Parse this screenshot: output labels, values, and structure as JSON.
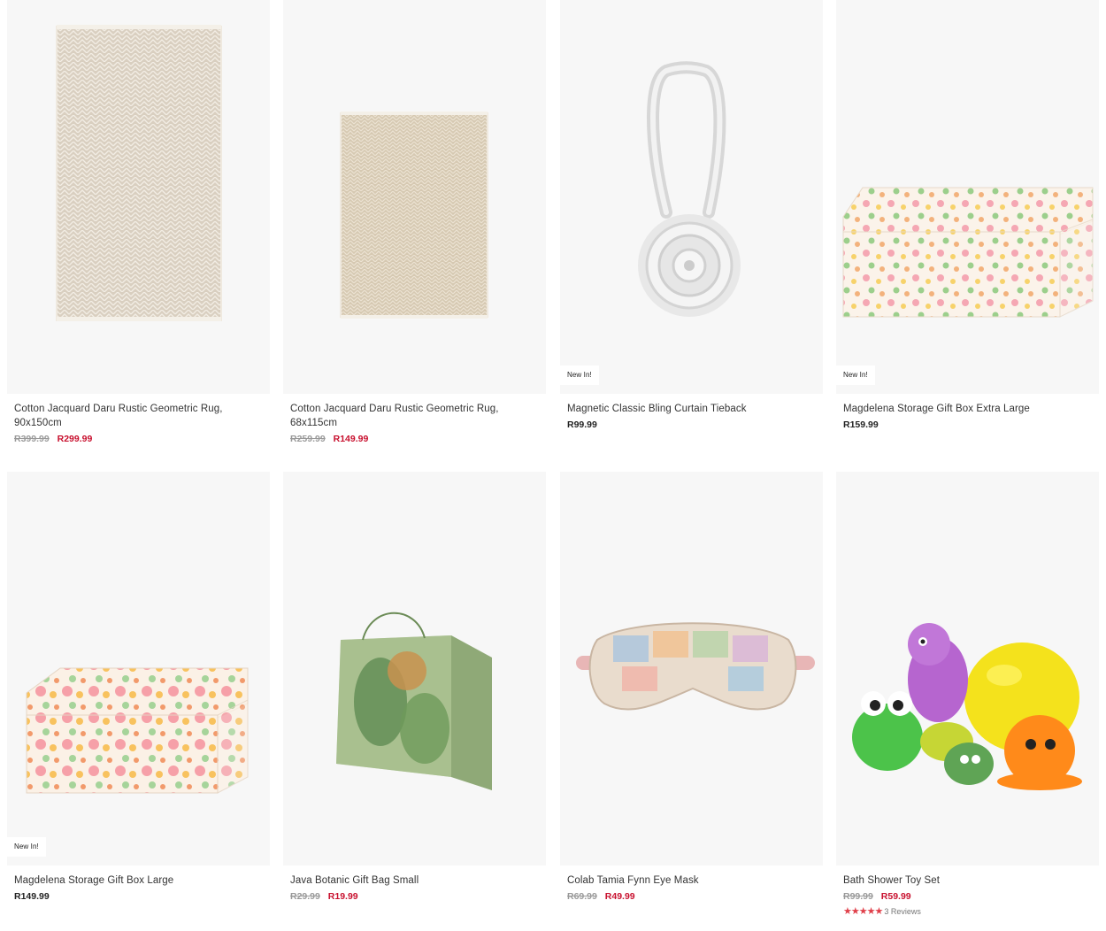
{
  "products": [
    {
      "title": "Cotton Jacquard Daru Rustic Geometric Rug, 90x150cm",
      "was": "R399.99",
      "price": "R299.99",
      "badge": "",
      "image": "rug-large"
    },
    {
      "title": "Cotton Jacquard Daru Rustic Geometric Rug, 68x115cm",
      "was": "R259.99",
      "price": "R149.99",
      "badge": "",
      "image": "rug-small"
    },
    {
      "title": "Magnetic Classic Bling Curtain Tieback",
      "was": "",
      "price": "R99.99",
      "badge": "New In!",
      "image": "curtain-tieback"
    },
    {
      "title": "Magdelena Storage Gift Box Extra Large",
      "was": "",
      "price": "R159.99",
      "badge": "New In!",
      "image": "floral-box-xl"
    },
    {
      "title": "Magdelena Storage Gift Box Large",
      "was": "",
      "price": "R149.99",
      "badge": "New In!",
      "image": "floral-box-large"
    },
    {
      "title": "Java Botanic Gift Bag Small",
      "was": "R29.99",
      "price": "R19.99",
      "badge": "",
      "image": "botanic-gift-bag"
    },
    {
      "title": "Colab Tamia Fynn Eye Mask",
      "was": "R69.99",
      "price": "R49.99",
      "badge": "",
      "image": "eye-mask"
    },
    {
      "title": "Bath Shower Toy Set",
      "was": "R99.99",
      "price": "R59.99",
      "badge": "",
      "image": "bath-toys",
      "rating": 5,
      "reviews": "3 Reviews"
    }
  ],
  "colors": {
    "sale": "#c8102e",
    "star": "#e0404a",
    "card_bg": "#f7f7f7"
  }
}
